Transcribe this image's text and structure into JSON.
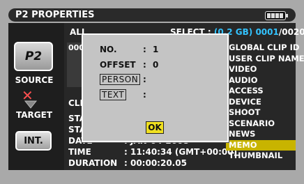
{
  "title": "P2 PROPERTIES",
  "header": {
    "filter": "ALL",
    "select_prefix": "SELECT : ",
    "select_size": "(0.2 GB)",
    "select_count": "0001",
    "select_total": "/0020"
  },
  "left": {
    "p2_label": "P2",
    "source": "SOURCE",
    "x_mark": "✕",
    "target": "TARGET",
    "int_label": "INT."
  },
  "thumbnail": {
    "clip_number": "0001"
  },
  "info": {
    "clip_label": "CLIP",
    "start1_label": "STAF",
    "start2_label": "STAF",
    "date_label": "DATE",
    "date_value": ": JAN-04-2008",
    "time_label": "TIME",
    "time_value": ": 11:40:34 (GMT+00:00)",
    "duration_label": "DURATION",
    "duration_value": ": 00:00:20.05"
  },
  "menu": [
    "GLOBAL CLIP ID",
    "USER CLIP NAME",
    "VIDEO",
    "AUDIO",
    "ACCESS",
    "DEVICE",
    "SHOOT",
    "SCENARIO",
    "NEWS",
    "MEMO",
    "THUMBNAIL"
  ],
  "active_menu": "MEMO",
  "dialog": {
    "no_label": "NO.",
    "no_value": "1",
    "offset_label": "OFFSET",
    "offset_value": "0",
    "person_label": "PERSON",
    "text_label": "TEXT",
    "colon": ":",
    "ok_label": "OK"
  },
  "colors": {
    "accent_blue": "#33c3ff",
    "active_yellow": "#c8b400",
    "ok_yellow": "#f0e020"
  }
}
